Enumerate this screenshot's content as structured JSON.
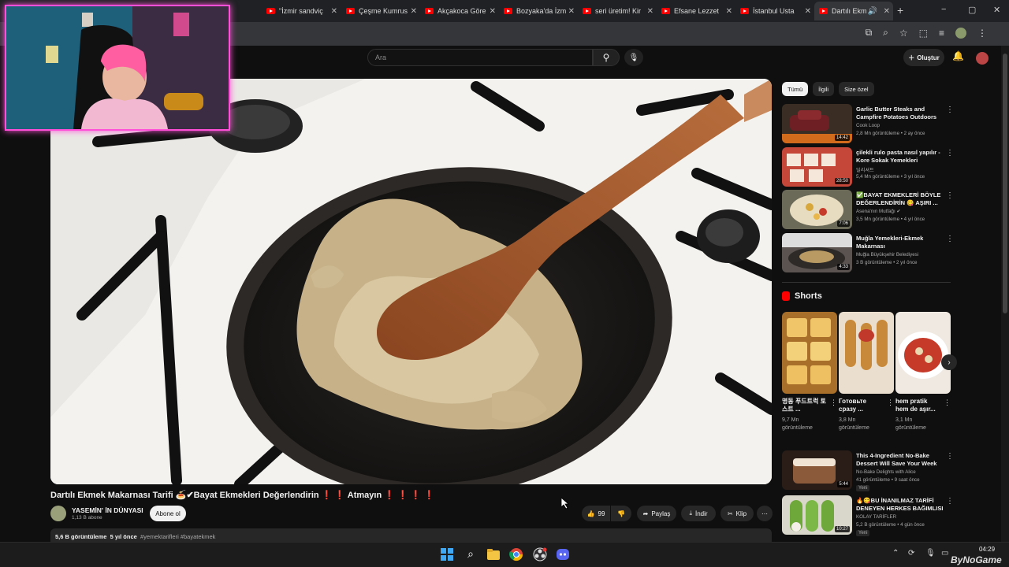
{
  "browser": {
    "tabs": [
      {
        "label": "\"İzmir sandviç"
      },
      {
        "label": "Çeşme Kumrus"
      },
      {
        "label": "Akçakoca Göre"
      },
      {
        "label": "Bozyaka'da İzm"
      },
      {
        "label": "seri üretim! Kir"
      },
      {
        "label": "Efsane Lezzet"
      },
      {
        "label": "İstanbul Usta"
      },
      {
        "label": "Dartılı Ekm"
      }
    ],
    "new_tab": "+",
    "window_controls": [
      "−",
      "▢",
      "✕"
    ]
  },
  "header": {
    "search_placeholder": "Ara",
    "create_label": "Oluştur"
  },
  "video": {
    "title": "Dartılı Ekmek Makarnası Tarifi 🍝✔Bayat Ekmekleri Değerlendirin ❗ ❗ Atmayın ❗ ❗ ❗ ❗",
    "channel": "YASEMİN' İN DÜNYASI",
    "subscribers": "1,13 B abone",
    "subscribe_label": "Abone ol",
    "likes": "99",
    "share_label": "Paylaş",
    "download_label": "İndir",
    "clip_label": "Klip",
    "views": "5,6 B görüntüleme",
    "age": "5 yıl önce",
    "tags": "#yemektarifleri #bayatekmek"
  },
  "sidebar": {
    "chips": [
      "Tümü",
      "İlgili",
      "Size özel"
    ],
    "recommendations": [
      {
        "title": "Garlic Butter Steaks and Campfire Potatoes Outdoors",
        "channel": "Cook Loop",
        "meta": "2,8 Mn görüntüleme • 2 ay önce",
        "duration": "14:42",
        "thumb": "steak"
      },
      {
        "title": "çilekli rulo pasta nasıl yapılır - Kore Sokak Yemekleri",
        "channel": "딜리셔트",
        "meta": "5,4 Mn görüntüleme • 3 yıl önce",
        "duration": "28:50",
        "thumb": "cake"
      },
      {
        "title": "✅BAYAT EKMEKLERİ BÖYLE DEĞERLENDİRİN 😋 AŞIRI ...",
        "channel": "Asena'nın Mutfağı ✔",
        "meta": "3,5 Mn görüntüleme • 4 yıl önce",
        "duration": "7:06",
        "thumb": "bread"
      },
      {
        "title": "Muğla Yemekleri-Ekmek Makarnası",
        "channel": "Muğla Büyükşehir Belediyesi",
        "meta": "3 B görüntüleme • 2 yıl önce",
        "duration": "4:33",
        "thumb": "pasta"
      }
    ],
    "shorts_title": "Shorts",
    "shorts": [
      {
        "title": "명동 푸드트럭 토스트 ...",
        "views": "9,7 Mn görüntüleme"
      },
      {
        "title": "Готовьте сразу ...",
        "views": "3,8 Mn görüntüleme"
      },
      {
        "title": "hem pratik hem de aşır...",
        "views": "3,1 Mn görüntüleme"
      }
    ],
    "more_recommendations": [
      {
        "title": "This 4-Ingredient No-Bake Dessert Will Save Your Week (...",
        "channel": "No-Bake Delights with Alice",
        "meta": "41 görüntüleme • 9 saat önce",
        "duration": "5:44",
        "badge": "Yeni"
      },
      {
        "title": "🔥😋BU İNANILMAZ TARİFİ DENEYEN HERKES BAĞIMLISI ...",
        "channel": "KOLAY TARİFLER",
        "meta": "5,2 B görüntüleme • 4 gün önce",
        "duration": "10:27",
        "badge": "Yeni"
      }
    ]
  },
  "taskbar": {
    "time": "04:29",
    "watermark": "ByNoGame"
  }
}
